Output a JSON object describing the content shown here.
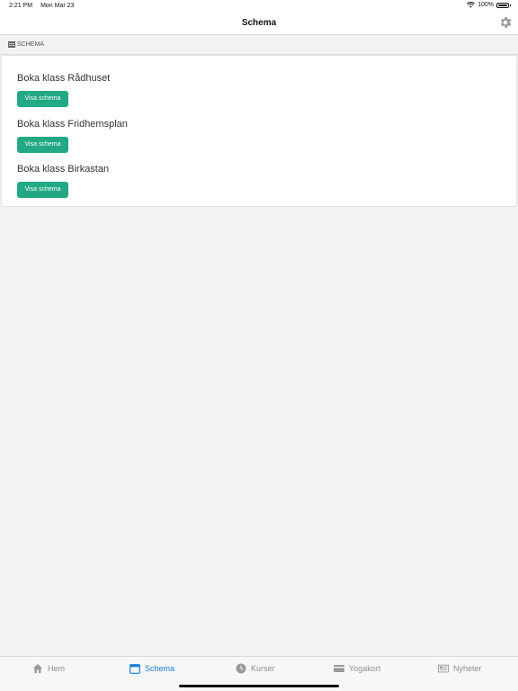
{
  "status_bar": {
    "time": "2:21 PM",
    "date": "Mon Mar 23",
    "battery": "100%"
  },
  "nav": {
    "title": "Schema"
  },
  "section": {
    "title": "SCHEMA"
  },
  "classes": [
    {
      "title": "Boka klass Rådhuset",
      "button_label": "Visa schema"
    },
    {
      "title": "Boka klass Fridhemsplan",
      "button_label": "Visa schema"
    },
    {
      "title": "Boka klass Birkastan",
      "button_label": "Visa schema"
    }
  ],
  "tabs": [
    {
      "label": "Hem",
      "icon": "home-icon",
      "active": false
    },
    {
      "label": "Schema",
      "icon": "calendar-icon",
      "active": true
    },
    {
      "label": "Kurser",
      "icon": "clock-icon",
      "active": false
    },
    {
      "label": "Yogakort",
      "icon": "card-icon",
      "active": false
    },
    {
      "label": "Nyheter",
      "icon": "newspaper-icon",
      "active": false
    }
  ],
  "colors": {
    "accent": "#22a884",
    "active_tab": "#1a7fd4",
    "inactive_tab": "#8e8e8e",
    "background": "#f2f2f2"
  }
}
